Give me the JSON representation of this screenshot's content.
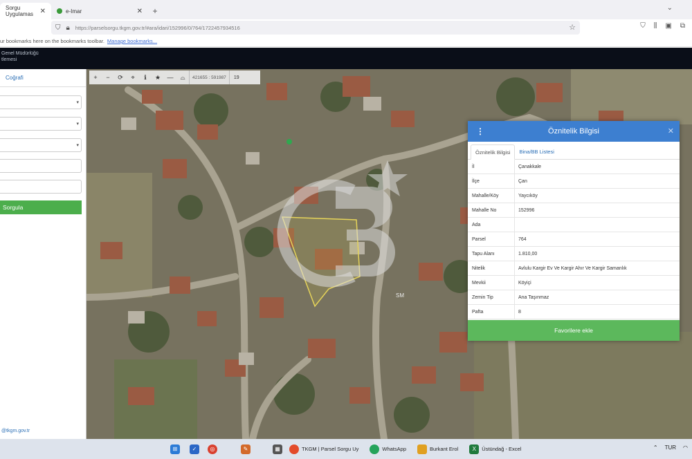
{
  "browser": {
    "tabs": [
      {
        "label": "Sorgu Uygulamas"
      },
      {
        "label": "e-Imar"
      }
    ],
    "url": "https://parselsorgu.tkgm.gov.tr/#ara/idari/152996/0/764/1722457934516",
    "bookmarks_text": "ur bookmarks here on the bookmarks toolbar.",
    "bookmarks_link": "Manage bookmarks..."
  },
  "app_header": {
    "line1": "Genel Müdürlüğü",
    "line2": "tlemesi"
  },
  "sidebar": {
    "tab_label": "Coğrafi",
    "button_label": "Sorgula",
    "footer_text": "@tkgm.gov.tr"
  },
  "map_toolbar": {
    "coordinates": "421655 : 591987",
    "zoom": "19"
  },
  "map_labels": {
    "watermark": "CB",
    "badge": "SM"
  },
  "panel": {
    "title": "Öznitelik Bilgisi",
    "tabs": [
      "Öznitelik Bilgisi",
      "Bina/BB Listesi"
    ],
    "rows": [
      {
        "key": "İl",
        "value": "Çanakkale"
      },
      {
        "key": "İlçe",
        "value": "Çan"
      },
      {
        "key": "Mahalle/Köy",
        "value": "Yaycıköy"
      },
      {
        "key": "Mahalle No",
        "value": "152996"
      },
      {
        "key": "Ada",
        "value": ""
      },
      {
        "key": "Parsel",
        "value": "764"
      },
      {
        "key": "Tapu Alanı",
        "value": "1.810,00"
      },
      {
        "key": "Nitelik",
        "value": "Avlulu Kargir Ev Ve Kargir Ahır Ve Kargir Samanlık"
      },
      {
        "key": "Mevkii",
        "value": "Köyiçi"
      },
      {
        "key": "Zemin Tip",
        "value": "Ana Taşınmaz"
      },
      {
        "key": "Pafta",
        "value": "8"
      }
    ],
    "favorite_button": "Favorilere ekle"
  },
  "taskbar": {
    "items": [
      {
        "label": "TKGM | Parsel Sorgu Uy",
        "color": "#e34b2a"
      },
      {
        "label": "WhatsApp",
        "color": "#25a35a"
      },
      {
        "label": "Burkant Erol",
        "color": "#e0a020"
      },
      {
        "label": "Üstündağ - Excel",
        "color": "#1f7a3c"
      }
    ],
    "tray": {
      "lang": "TUR"
    }
  }
}
